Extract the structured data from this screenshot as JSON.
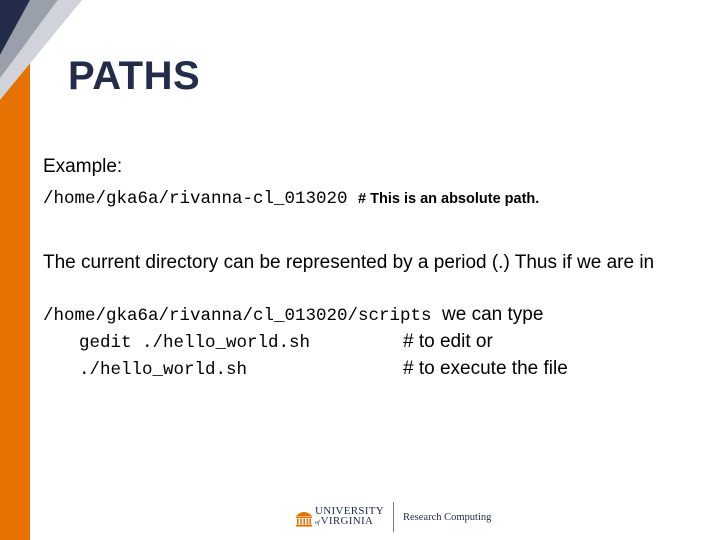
{
  "slide": {
    "title": "PATHS",
    "example_label": "Example:",
    "abs_path": "/home/gka6a/rivanna-cl_013020",
    "abs_note": "# This is an absolute path.",
    "current_dir_text": "The current directory can be represented by a period (.) Thus if we are in",
    "rel_path": "/home/gka6a/rivanna/cl_013020/scripts",
    "we_can_type": "we can type",
    "cmd1": "gedit ./hello_world.sh",
    "cmd1_comment": "# to edit or",
    "cmd2": "./hello_world.sh",
    "cmd2_comment": "# to execute the file"
  },
  "footer": {
    "university_line1": "UNIVERSITY",
    "university_of": "of",
    "university_line2": "VIRGINIA",
    "department": "Research Computing"
  },
  "colors": {
    "accent_orange": "#e57200",
    "navy": "#232d4b"
  }
}
